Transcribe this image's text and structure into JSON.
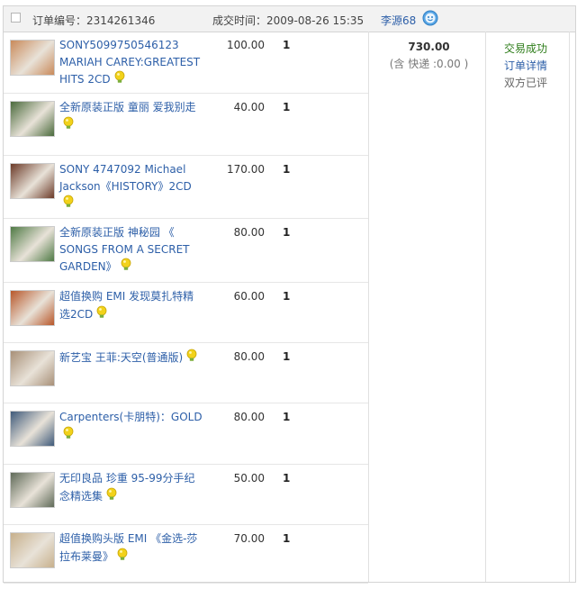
{
  "order": {
    "number_label": "订单编号：2314261346",
    "time_label": "成交时间：2009-08-26 15:35",
    "seller": "李源68",
    "total_amount": "730.00",
    "shipping": "(含 快递 :0.00 )",
    "status": {
      "trade": "交易成功",
      "details": "订单详情",
      "rated": "双方已评"
    },
    "items": [
      {
        "title": "SONY5099750546123 MARIAH CAREY:GREATEST HITS 2CD",
        "price": "100.00",
        "qty": "1",
        "cover": "#c98a5a"
      },
      {
        "title": "全新原装正版 童丽 爱我别走",
        "price": "40.00",
        "qty": "1",
        "cover": "#4a6a3c"
      },
      {
        "title": "SONY 4747092 Michael Jackson《HISTORY》2CD",
        "price": "170.00",
        "qty": "1",
        "cover": "#6b3a28"
      },
      {
        "title": "全新原装正版 神秘园 《 SONGS FROM A SECRET GARDEN》",
        "price": "80.00",
        "qty": "1",
        "cover": "#4f7a45"
      },
      {
        "title": "超值换购 EMI 发现莫扎特精选2CD",
        "price": "60.00",
        "qty": "1",
        "cover": "#b8572a"
      },
      {
        "title": "新艺宝 王菲:天空(普通版)",
        "price": "80.00",
        "qty": "1",
        "cover": "#a89078"
      },
      {
        "title": "Carpenters(卡朋特)：GOLD",
        "price": "80.00",
        "qty": "1",
        "cover": "#3f5a7a"
      },
      {
        "title": "无印良品 珍重 95-99分手纪念精选集",
        "price": "50.00",
        "qty": "1",
        "cover": "#5f6a58"
      },
      {
        "title": "超值换购头版 EMI 《金选-莎拉布莱曼》",
        "price": "70.00",
        "qty": "1",
        "cover": "#c7b08c"
      }
    ]
  },
  "icons": {
    "checkbox": "checkbox-icon",
    "wangwang": "chat-bubble-icon",
    "bulb": "lightbulb-icon"
  }
}
